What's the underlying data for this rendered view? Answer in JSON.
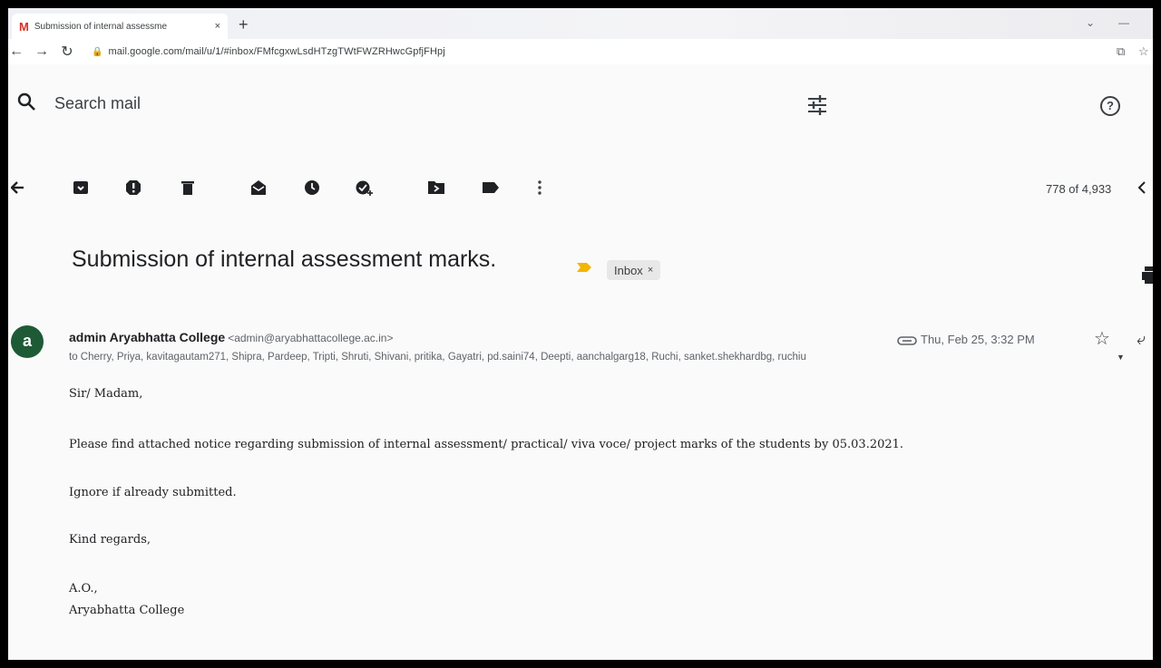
{
  "browser": {
    "tab_icon": "M",
    "tab_title": "Submission of internal assessme",
    "tab_close": "×",
    "new_tab": "+",
    "url": "mail.google.com/mail/u/1/#inbox/FMfcgxwLsdHTzgTWtFWZRHwcGpfjFHpj"
  },
  "search": {
    "placeholder": "Search mail"
  },
  "toolbar": {
    "counter": "778 of 4,933"
  },
  "email": {
    "subject": "Submission of internal assessment marks.",
    "label": "Inbox",
    "label_remove": "×",
    "avatar_letter": "a",
    "sender_name": "admin Aryabhatta College",
    "sender_email": "<admin@aryabhattacollege.ac.in>",
    "date": "Thu, Feb 25, 3:32 PM",
    "recipients": "to Cherry, Priya, kavitagautam271, Shipra, Pardeep, Tripti, Shruti, Shivani, pritika, Gayatri, pd.saini74, Deepti, aanchalgarg18, Ruchi, sanket.shekhardbg, ruchiu",
    "body": {
      "greeting": "Sir/ Madam,",
      "paragraph1": "Please find attached notice regarding submission of internal assessment/ practical/ viva voce/ project marks of the students by 05.03.2021.",
      "paragraph2": "Ignore if already submitted.",
      "closing": "Kind regards,",
      "signature_line1": "A.O.,",
      "signature_line2": "Aryabhatta College"
    }
  },
  "colors": {
    "avatar_bg": "#1e5a36",
    "important_marker": "#f4b400",
    "gmail_red": "#d93025"
  }
}
